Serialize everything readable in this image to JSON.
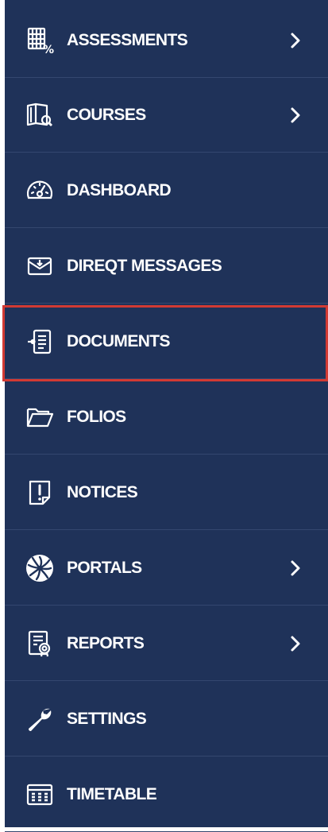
{
  "nav": {
    "items": [
      {
        "label": "ASSESSMENTS",
        "icon": "assessments-icon",
        "has_submenu": true
      },
      {
        "label": "COURSES",
        "icon": "courses-icon",
        "has_submenu": true
      },
      {
        "label": "DASHBOARD",
        "icon": "dashboard-icon",
        "has_submenu": false
      },
      {
        "label": "DIREQT MESSAGES",
        "icon": "messages-icon",
        "has_submenu": false
      },
      {
        "label": "DOCUMENTS",
        "icon": "documents-icon",
        "has_submenu": false,
        "highlighted": true
      },
      {
        "label": "FOLIOS",
        "icon": "folder-icon",
        "has_submenu": false
      },
      {
        "label": "NOTICES",
        "icon": "notices-icon",
        "has_submenu": false
      },
      {
        "label": "PORTALS",
        "icon": "portals-icon",
        "has_submenu": true
      },
      {
        "label": "REPORTS",
        "icon": "reports-icon",
        "has_submenu": true
      },
      {
        "label": "SETTINGS",
        "icon": "wrench-icon",
        "has_submenu": false
      },
      {
        "label": "TIMETABLE",
        "icon": "timetable-icon",
        "has_submenu": false
      }
    ]
  },
  "colors": {
    "sidebar_background": "#1f3259",
    "divider": "#34476f",
    "text": "#ffffff",
    "highlight_border": "#d23a33"
  }
}
